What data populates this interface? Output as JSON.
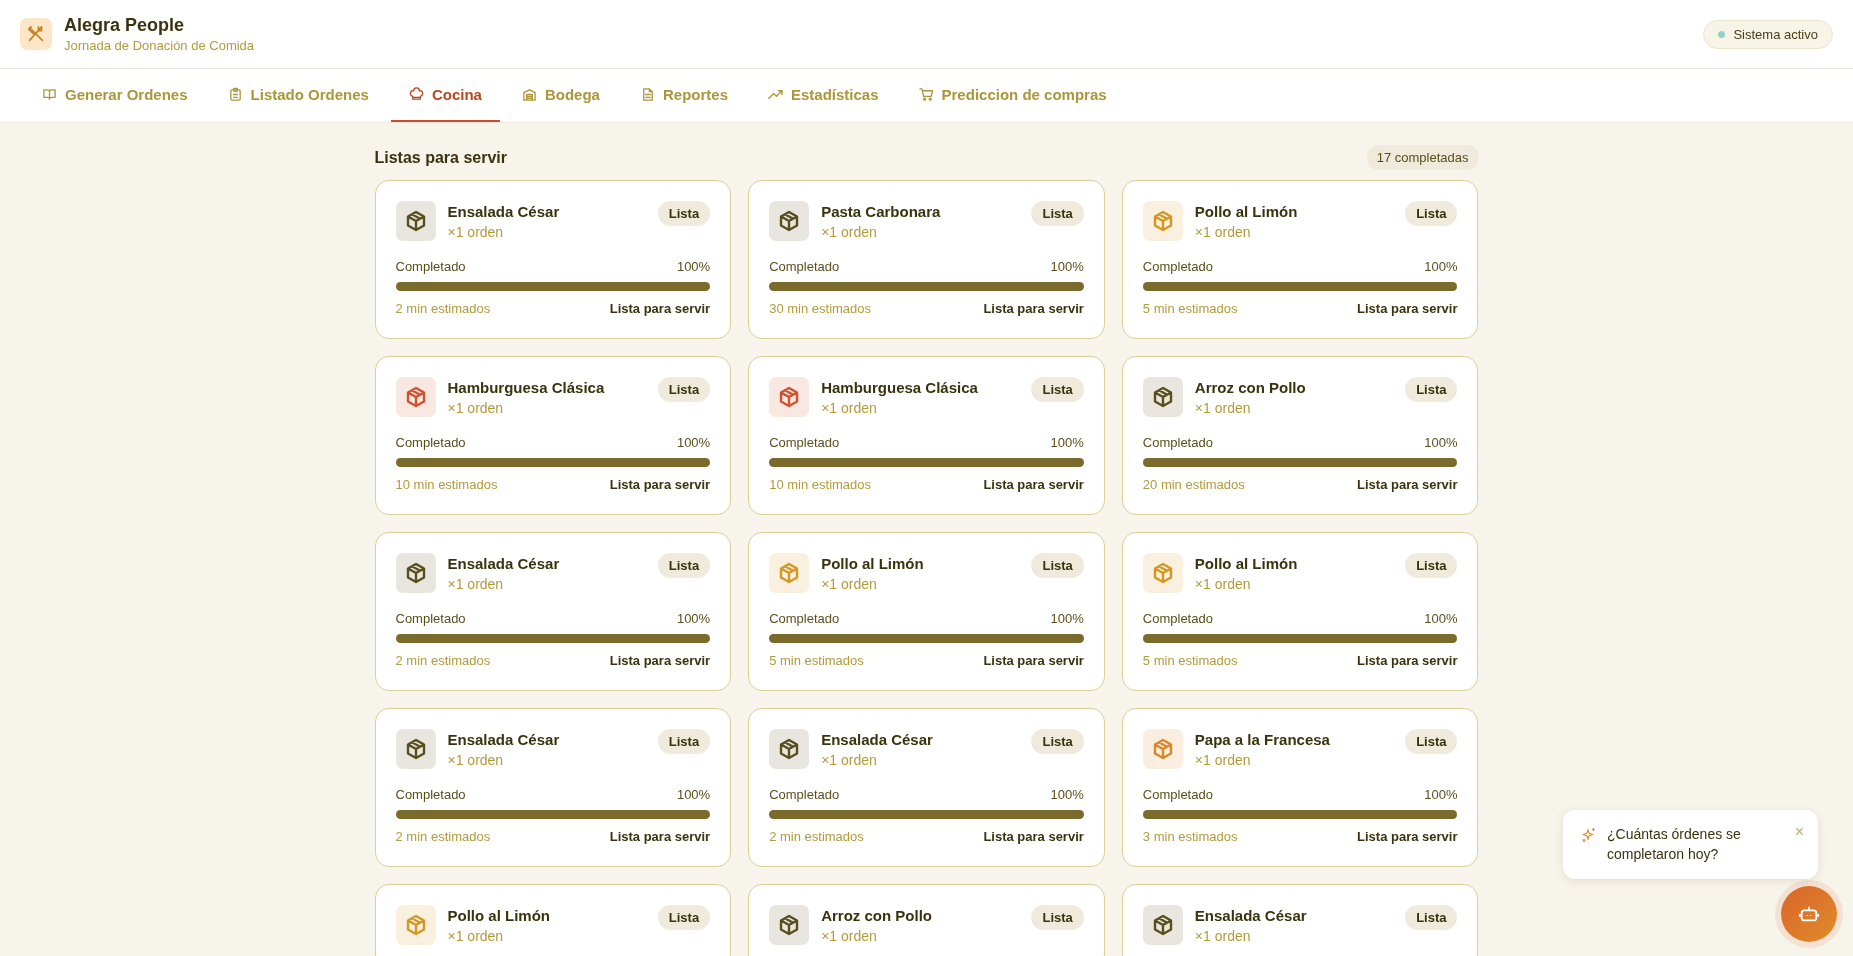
{
  "app": {
    "title": "Alegra People",
    "subtitle": "Jornada de Donación de Comida"
  },
  "status": {
    "label": "Sistema activo",
    "color": "#8fd3c8"
  },
  "tabs": [
    {
      "label": "Generar Ordenes",
      "selected": false
    },
    {
      "label": "Listado Ordenes",
      "selected": false
    },
    {
      "label": "Cocina",
      "selected": true
    },
    {
      "label": "Bodega",
      "selected": false
    },
    {
      "label": "Reportes",
      "selected": false
    },
    {
      "label": "Estadísticas",
      "selected": false
    },
    {
      "label": "Prediccion de compras",
      "selected": false
    }
  ],
  "section": {
    "title": "Listas para servir",
    "count": "17 completadas"
  },
  "cards": [
    {
      "name": "Ensalada César",
      "orders": "×1 orden",
      "badge": "Lista",
      "color": "#5a4e1c",
      "progress_label": "Completado",
      "percent": "100%",
      "level": 1,
      "estimate": "2 min estimados",
      "state": "Lista para servir"
    },
    {
      "name": "Pasta Carbonara",
      "orders": "×1 orden",
      "badge": "Lista",
      "color": "#5a4e1c",
      "progress_label": "Completado",
      "percent": "100%",
      "level": 1,
      "estimate": "30 min estimados",
      "state": "Lista para servir"
    },
    {
      "name": "Pollo al Limón",
      "orders": "×1 orden",
      "badge": "Lista",
      "color": "#d4971f",
      "progress_label": "Completado",
      "percent": "100%",
      "level": 1,
      "estimate": "5 min estimados",
      "state": "Lista para servir"
    },
    {
      "name": "Hamburguesa Clásica",
      "orders": "×1 orden",
      "badge": "Lista",
      "color": "#d4502c",
      "progress_label": "Completado",
      "percent": "100%",
      "level": 1,
      "estimate": "10 min estimados",
      "state": "Lista para servir"
    },
    {
      "name": "Hamburguesa Clásica",
      "orders": "×1 orden",
      "badge": "Lista",
      "color": "#d4502c",
      "progress_label": "Completado",
      "percent": "100%",
      "level": 1,
      "estimate": "10 min estimados",
      "state": "Lista para servir"
    },
    {
      "name": "Arroz con Pollo",
      "orders": "×1 orden",
      "badge": "Lista",
      "color": "#5a4e1c",
      "progress_label": "Completado",
      "percent": "100%",
      "level": 1,
      "estimate": "20 min estimados",
      "state": "Lista para servir"
    },
    {
      "name": "Ensalada César",
      "orders": "×1 orden",
      "badge": "Lista",
      "color": "#5a4e1c",
      "progress_label": "Completado",
      "percent": "100%",
      "level": 1,
      "estimate": "2 min estimados",
      "state": "Lista para servir"
    },
    {
      "name": "Pollo al Limón",
      "orders": "×1 orden",
      "badge": "Lista",
      "color": "#d4971f",
      "progress_label": "Completado",
      "percent": "100%",
      "level": 1,
      "estimate": "5 min estimados",
      "state": "Lista para servir"
    },
    {
      "name": "Pollo al Limón",
      "orders": "×1 orden",
      "badge": "Lista",
      "color": "#d4971f",
      "progress_label": "Completado",
      "percent": "100%",
      "level": 1,
      "estimate": "5 min estimados",
      "state": "Lista para servir"
    },
    {
      "name": "Ensalada César",
      "orders": "×1 orden",
      "badge": "Lista",
      "color": "#5a4e1c",
      "progress_label": "Completado",
      "percent": "100%",
      "level": 1,
      "estimate": "2 min estimados",
      "state": "Lista para servir"
    },
    {
      "name": "Ensalada César",
      "orders": "×1 orden",
      "badge": "Lista",
      "color": "#5a4e1c",
      "progress_label": "Completado",
      "percent": "100%",
      "level": 1,
      "estimate": "2 min estimados",
      "state": "Lista para servir"
    },
    {
      "name": "Papa a la Francesa",
      "orders": "×1 orden",
      "badge": "Lista",
      "color": "#dd8524",
      "progress_label": "Completado",
      "percent": "100%",
      "level": 1,
      "estimate": "3 min estimados",
      "state": "Lista para servir"
    },
    {
      "name": "Pollo al Limón",
      "orders": "×1 orden",
      "badge": "Lista",
      "color": "#d4971f"
    },
    {
      "name": "Arroz con Pollo",
      "orders": "×1 orden",
      "badge": "Lista",
      "color": "#5a4e1c"
    },
    {
      "name": "Ensalada César",
      "orders": "×1 orden",
      "badge": "Lista",
      "color": "#5a4e1c"
    }
  ],
  "assistant": {
    "suggestion": "¿Cuántas órdenes se completaron hoy?",
    "close": "×"
  }
}
